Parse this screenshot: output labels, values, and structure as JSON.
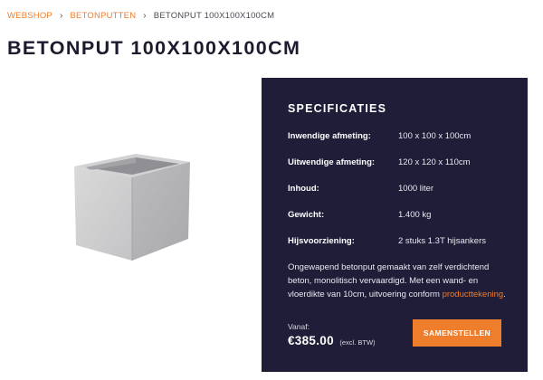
{
  "breadcrumb": {
    "items": [
      "WEBSHOP",
      "BETONPUTTEN",
      "BETONPUT 100X100X100CM"
    ],
    "separator": "›"
  },
  "page_title": "BETONPUT 100X100X100CM",
  "product_image": {
    "alt_icon": "concrete-box-icon"
  },
  "specs": {
    "heading": "SPECIFICATIES",
    "rows": [
      {
        "label": "Inwendige afmeting:",
        "value": "100 x 100 x 100cm"
      },
      {
        "label": "Uitwendige afmeting:",
        "value": "120 x 120 x 110cm"
      },
      {
        "label": "Inhoud:",
        "value": "1000 liter"
      },
      {
        "label": "Gewicht:",
        "value": "1.400 kg"
      },
      {
        "label": "Hijsvoorziening:",
        "value": "2 stuks 1.3T hijsankers"
      }
    ],
    "description": "Ongewapend betonput gemaakt van zelf verdichtend beton, monolitisch vervaardigd. Met een wand- en vloerdikte van 10cm, uitvoering conform ",
    "description_link": "producttekening",
    "description_end": "."
  },
  "price": {
    "caption": "Vanaf:",
    "amount": "€385.00",
    "note": "(excl. BTW)"
  },
  "cta": {
    "label": "SAMENSTELLEN"
  },
  "colors": {
    "accent": "#ee7d2c",
    "panel": "#1f1d38",
    "title": "#1c1b2e"
  }
}
